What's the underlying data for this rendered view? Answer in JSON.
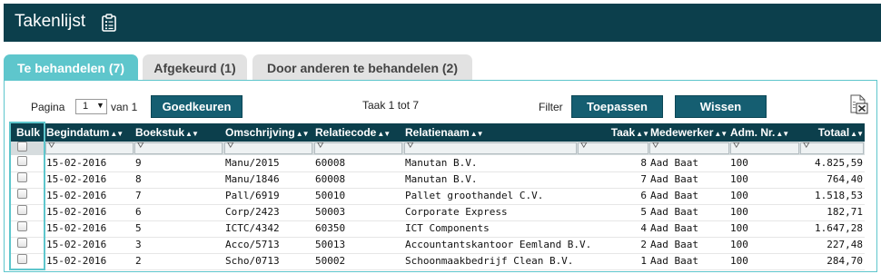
{
  "header": {
    "title": "Takenlijst",
    "icon": "clipboard-icon"
  },
  "tabs": [
    {
      "label": "Te behandelen (7)",
      "active": true
    },
    {
      "label": "Afgekeurd (1)",
      "active": false
    },
    {
      "label": "Door anderen te behandelen (2)",
      "active": false
    }
  ],
  "toolbar": {
    "page_label": "Pagina",
    "page_value": "1",
    "page_of": "van 1",
    "approve_button": "Goedkeuren",
    "range_text": "Taak 1 tot 7",
    "filter_label": "Filter",
    "apply_button": "Toepassen",
    "clear_button": "Wissen",
    "export_icon": "excel-export-icon"
  },
  "table": {
    "columns": [
      "Bulk",
      "Begindatum",
      "Boekstuk",
      "Omschrijving",
      "Relatiecode",
      "Relatienaam",
      "Taak",
      "Medewerker",
      "Adm. Nr.",
      "Totaal"
    ],
    "rows": [
      [
        "15-02-2016",
        "9",
        "Manu/2015",
        "60008",
        "Manutan B.V.",
        "8",
        "Aad Baat",
        "100",
        "4.825,59"
      ],
      [
        "15-02-2016",
        "8",
        "Manu/1846",
        "60008",
        "Manutan B.V.",
        "7",
        "Aad Baat",
        "100",
        "764,40"
      ],
      [
        "15-02-2016",
        "7",
        "Pall/6919",
        "50010",
        "Pallet groothandel C.V.",
        "6",
        "Aad Baat",
        "100",
        "1.518,53"
      ],
      [
        "15-02-2016",
        "6",
        "Corp/2423",
        "50003",
        "Corporate Express",
        "5",
        "Aad Baat",
        "100",
        "182,71"
      ],
      [
        "15-02-2016",
        "5",
        "ICTC/4342",
        "60350",
        "ICT Components",
        "4",
        "Aad Baat",
        "100",
        "1.647,28"
      ],
      [
        "15-02-2016",
        "3",
        "Acco/5713",
        "50013",
        "Accountantskantoor Eemland B.V.",
        "2",
        "Aad Baat",
        "100",
        "227,48"
      ],
      [
        "15-02-2016",
        "2",
        "Scho/0713",
        "50002",
        "Schoonmaakbedrijf Clean B.V.",
        "1",
        "Aad Baat",
        "100",
        "284,70"
      ]
    ]
  },
  "colors": {
    "header_bg": "#0c3f4c",
    "accent": "#5ec6cc",
    "button": "#155e71"
  }
}
